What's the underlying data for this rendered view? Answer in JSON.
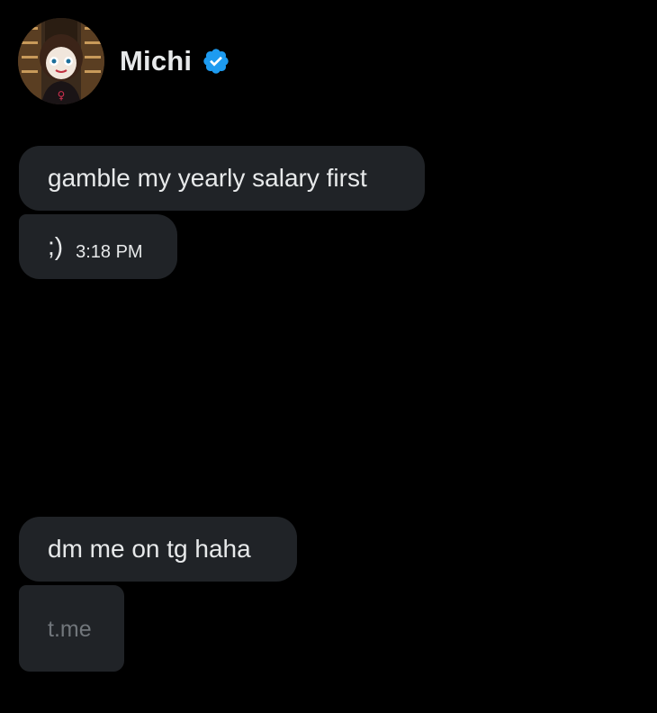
{
  "contact": {
    "name": "Michi",
    "verified_badge_color": "#1d9bf0"
  },
  "messages": [
    {
      "text": "gamble my yearly salary first"
    },
    {
      "text": ";)",
      "time": "3:18 PM"
    },
    {
      "text": "dm me on tg haha"
    },
    {
      "link_domain": "t.me"
    }
  ],
  "colors": {
    "background": "#000000",
    "bubble": "#202327",
    "text": "#e7e9ea",
    "muted_text": "#71767b"
  }
}
